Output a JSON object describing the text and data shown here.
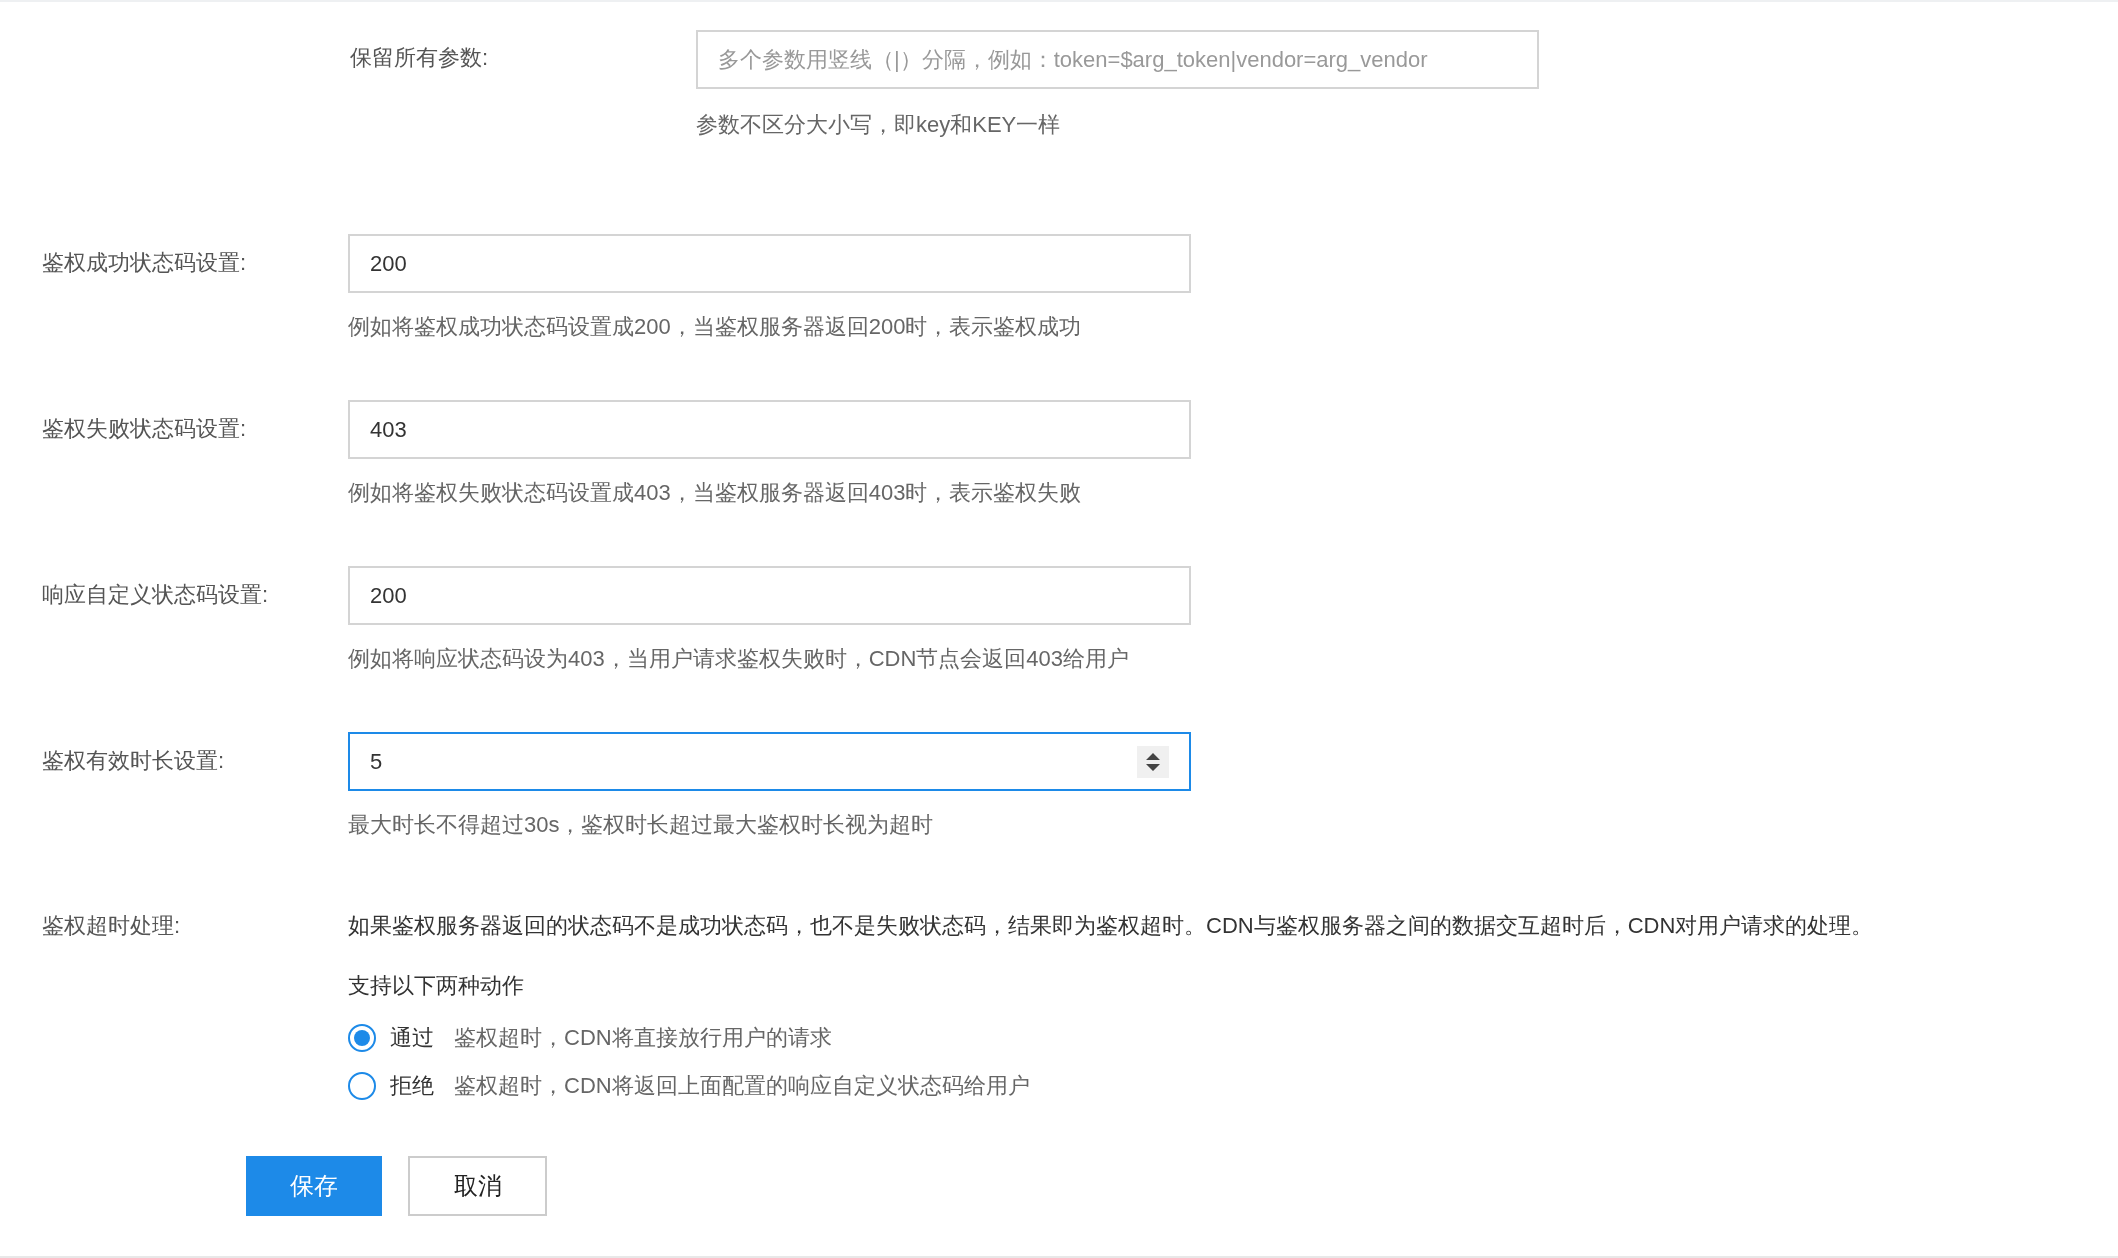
{
  "keep_params": {
    "label": "保留所有参数:",
    "placeholder": "多个参数用竖线（|）分隔，例如：token=$arg_token|vendor=arg_vendor",
    "hint": "参数不区分大小写，即key和KEY一样"
  },
  "fields": [
    {
      "kind": "text",
      "label": "鉴权成功状态码设置:",
      "value": "200",
      "focused": false,
      "hint": "例如将鉴权成功状态码设置成200，当鉴权服务器返回200时，表示鉴权成功"
    },
    {
      "kind": "text",
      "label": "鉴权失败状态码设置:",
      "value": "403",
      "focused": false,
      "hint": "例如将鉴权失败状态码设置成403，当鉴权服务器返回403时，表示鉴权失败"
    },
    {
      "kind": "text",
      "label": "响应自定义状态码设置:",
      "value": "200",
      "focused": false,
      "hint": "例如将响应状态码设为403，当用户请求鉴权失败时，CDN节点会返回403给用户"
    },
    {
      "kind": "number",
      "label": "鉴权有效时长设置:",
      "value": "5",
      "focused": true,
      "hint": "最大时长不得超过30s，鉴权时长超过最大鉴权时长视为超时"
    }
  ],
  "timeout": {
    "label": "鉴权超时处理:",
    "description": "如果鉴权服务器返回的状态码不是成功状态码，也不是失败状态码，结果即为鉴权超时。CDN与鉴权服务器之间的数据交互超时后，CDN对用户请求的处理。",
    "subtitle": "支持以下两种动作",
    "options": [
      {
        "label": "通过",
        "description": "鉴权超时，CDN将直接放行用户的请求",
        "selected": true
      },
      {
        "label": "拒绝",
        "description": "鉴权超时，CDN将返回上面配置的响应自定义状态码给用户",
        "selected": false
      }
    ]
  },
  "buttons": [
    {
      "label": "保存",
      "kind": "primary"
    },
    {
      "label": "取消",
      "kind": "default"
    }
  ]
}
